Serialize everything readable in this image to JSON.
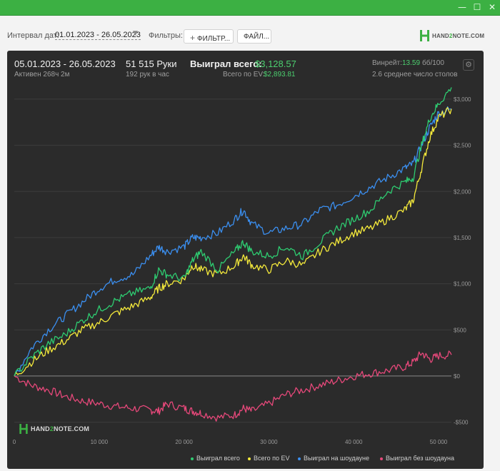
{
  "window": {
    "min_icon": "minimize-icon",
    "max_icon": "maximize-icon",
    "close_icon": "close-icon"
  },
  "toolbar": {
    "date_label": "Интервал дат:",
    "date_range": "01.01.2023 - 26.05.2023",
    "filters_label": "Фильтры:",
    "filter_button": "ФИЛЬТР...",
    "file_button": "ФАЙЛ...",
    "logo_pre": "HAND",
    "logo_two": "2",
    "logo_post": "NOTE.COM"
  },
  "summary": {
    "period": "05.01.2023 - 26.05.2023",
    "active": "Активен 268ч 2м",
    "hands": "51 515 Руки",
    "hands_per_hour": "192 рук в час",
    "won_label": "Выиграл всего:",
    "won_value": "$3,128.57",
    "ev_label": "Всего по EV:",
    "ev_value": "$2,893.81",
    "winrate_label": "Винрейт:",
    "winrate_value": "13.59",
    "winrate_unit": "бб/100",
    "tables": "2.6 среднее число столов"
  },
  "colors": {
    "won": "#2ecc71",
    "ev": "#f5ea3b",
    "showdown": "#3b8ff0",
    "nonshowdown": "#e6487a",
    "panel": "#2b2b2b",
    "accent": "#3cb043"
  },
  "chart_data": {
    "type": "line",
    "x_label": "",
    "y_label": "",
    "xlim": [
      0,
      51515
    ],
    "ylim": [
      -650,
      3100
    ],
    "x_ticks": [
      "0",
      "10 000",
      "20 000",
      "30 000",
      "40 000",
      "50 000"
    ],
    "y_ticks": [
      "$3,000",
      "$2,500",
      "$2,000",
      "$1,500",
      "$1,000",
      "$500",
      "$0",
      "-$500"
    ],
    "legend": "bottom",
    "grid": "horizontal",
    "x": [
      0,
      2000,
      4000,
      6000,
      8000,
      10000,
      12000,
      14000,
      16000,
      17000,
      18000,
      20000,
      21000,
      22000,
      24000,
      26000,
      27000,
      28000,
      30000,
      32000,
      34000,
      36000,
      38000,
      40000,
      42000,
      44000,
      46000,
      47000,
      48000,
      49000,
      50000,
      51515
    ],
    "series": [
      {
        "name": "Выиграл всего",
        "color_key": "won",
        "values": [
          0,
          200,
          350,
          450,
          600,
          720,
          820,
          900,
          950,
          1150,
          1100,
          1050,
          1250,
          1350,
          1150,
          1350,
          1450,
          1350,
          1300,
          1400,
          1300,
          1450,
          1600,
          1700,
          1800,
          2000,
          2100,
          2150,
          2500,
          2800,
          2950,
          3128
        ]
      },
      {
        "name": "Всего по EV",
        "color_key": "ev",
        "values": [
          0,
          150,
          280,
          380,
          500,
          580,
          680,
          760,
          850,
          950,
          1000,
          1050,
          1200,
          1150,
          1100,
          1200,
          1300,
          1200,
          1150,
          1250,
          1200,
          1350,
          1450,
          1550,
          1600,
          1700,
          1800,
          1900,
          2250,
          2600,
          2800,
          2894
        ]
      },
      {
        "name": "Выиграл на шоудауне",
        "color_key": "showdown",
        "values": [
          0,
          300,
          500,
          650,
          800,
          950,
          1050,
          1100,
          1300,
          1400,
          1350,
          1400,
          1500,
          1500,
          1550,
          1700,
          1800,
          1650,
          1550,
          1600,
          1650,
          1800,
          1850,
          1950,
          2050,
          2150,
          2250,
          2300,
          2500,
          2700,
          2850,
          2895
        ]
      },
      {
        "name": "Выиграл без шоудауна",
        "color_key": "nonshowdown",
        "values": [
          0,
          -100,
          -150,
          -220,
          -270,
          -300,
          -330,
          -350,
          -370,
          -380,
          -300,
          -350,
          -380,
          -400,
          -450,
          -420,
          -350,
          -380,
          -300,
          -200,
          -150,
          -100,
          -50,
          0,
          30,
          60,
          100,
          150,
          250,
          180,
          220,
          230
        ]
      }
    ]
  }
}
